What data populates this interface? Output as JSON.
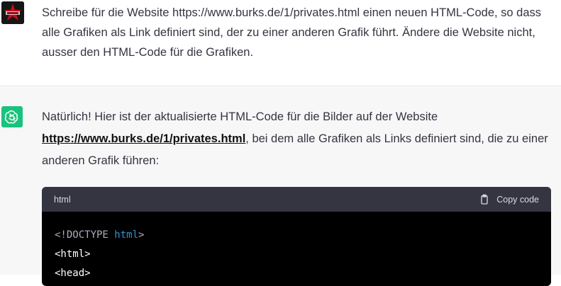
{
  "user_message": {
    "text": "Schreibe für die Website https://www.burks.de/1/privates.html einen neuen HTML-Code, so dass alle Grafiken als Link definiert sind, der zu einer anderen Grafik führt. Ändere die Website nicht, ausser den HTML-Code für die Grafiken."
  },
  "assistant_message": {
    "intro": "Natürlich! Hier ist der aktualisierte HTML-Code für die Bilder auf der Website ",
    "link": "https://www.burks.de/1/privates.html",
    "outro": ", bei dem alle Grafiken als Links definiert sind, die zu einer anderen Grafik führen:"
  },
  "code_block": {
    "language": "html",
    "copy_label": "Copy code",
    "lines": {
      "doctype_open": "<!DOCTYPE",
      "doctype_kw": "html",
      "doctype_close": ">",
      "line2": "<html>",
      "line3": "<head>"
    }
  },
  "colors": {
    "assistant_bg": "#f7f7f8",
    "avatar_green": "#19c37d",
    "code_header_bg": "#343541",
    "code_bg": "#000000",
    "keyword": "#2e95d3"
  },
  "icons": {
    "user_avatar": "red-star-avatar",
    "assistant_avatar": "openai-logo-icon",
    "copy": "clipboard-icon"
  }
}
